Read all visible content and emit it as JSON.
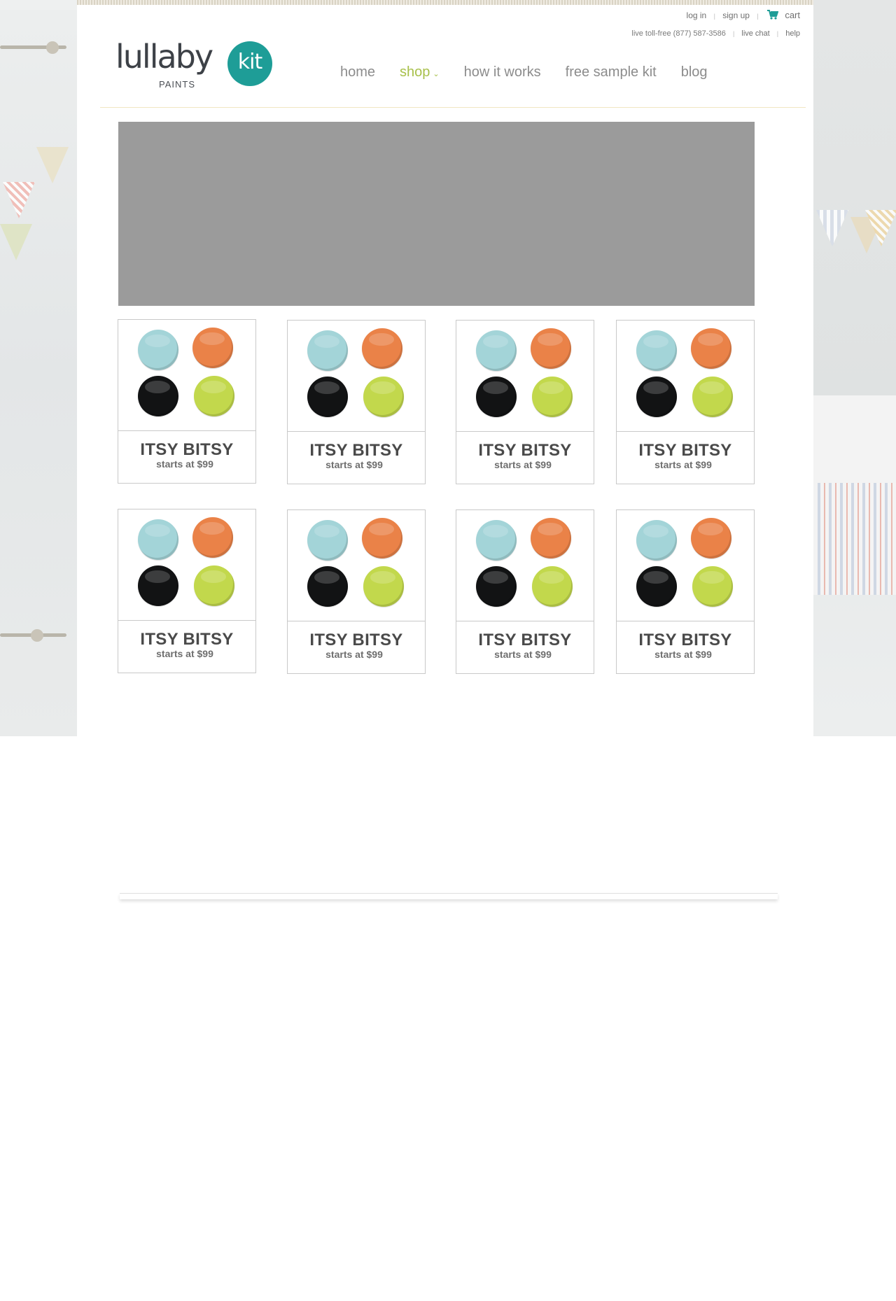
{
  "header": {
    "util_top": {
      "login": "log in",
      "signup": "sign up",
      "cart": "cart"
    },
    "util_bottom": {
      "phone": "live toll-free (877) 587-3586",
      "chat": "live chat",
      "help": "help"
    },
    "logo": {
      "word": "lullaby",
      "sub": "PAINTS",
      "badge": "kit"
    },
    "nav": [
      {
        "label": "home"
      },
      {
        "label": "shop"
      },
      {
        "label": "how it works"
      },
      {
        "label": "free sample kit"
      },
      {
        "label": "blog"
      }
    ]
  },
  "products": [
    {
      "title": "ITSY BITSY",
      "price": "starts at $99"
    },
    {
      "title": "ITSY BITSY",
      "price": "starts at $99"
    },
    {
      "title": "ITSY BITSY",
      "price": "starts at $99"
    },
    {
      "title": "ITSY BITSY",
      "price": "starts at $99"
    },
    {
      "title": "ITSY BITSY",
      "price": "starts at $99"
    },
    {
      "title": "ITSY BITSY",
      "price": "starts at $99"
    },
    {
      "title": "ITSY BITSY",
      "price": "starts at $99"
    },
    {
      "title": "ITSY BITSY",
      "price": "starts at $99"
    }
  ],
  "colors": {
    "accent_teal": "#1e9d97",
    "nav_active": "#a8c04a",
    "swatch_blue": "#a3d4d8",
    "swatch_orange": "#ea8248",
    "swatch_black": "#121314",
    "swatch_green": "#c2d84c",
    "hero": "#9b9b9b"
  },
  "icons": {
    "cart": "shopping-cart-icon",
    "shop_caret": "chevron-down-icon"
  }
}
